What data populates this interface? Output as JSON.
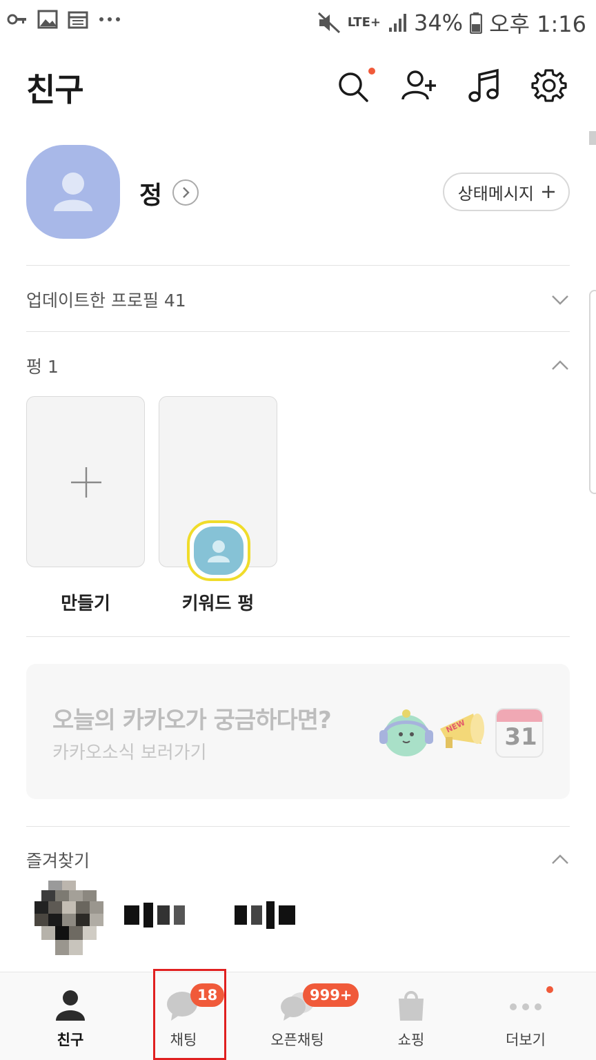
{
  "status_bar": {
    "network": "LTE+",
    "battery": "34%",
    "time": "오후 1:16"
  },
  "header": {
    "title": "친구"
  },
  "profile": {
    "name": "정",
    "status_button_label": "상태메시지"
  },
  "sections": {
    "updated_profiles": "업데이트한 프로필 41",
    "pung": "펑 1",
    "favorites": "즐겨찾기"
  },
  "pung_cards": [
    {
      "label": "만들기"
    },
    {
      "label": "키워드 펑"
    }
  ],
  "banner": {
    "title": "오늘의 카카오가 궁금하다면?",
    "subtitle": "카카오소식 보러가기",
    "calendar_number": "31",
    "sticker_text": "NEW"
  },
  "bottom_nav": {
    "items": [
      {
        "label": "친구"
      },
      {
        "label": "채팅",
        "badge": "18"
      },
      {
        "label": "오픈채팅",
        "badge": "999+"
      },
      {
        "label": "쇼핑"
      },
      {
        "label": "더보기"
      }
    ]
  },
  "colors": {
    "accent": "#f05a3a",
    "avatar": "#a8b8e8",
    "keyword_ring": "#f0dc2a"
  }
}
